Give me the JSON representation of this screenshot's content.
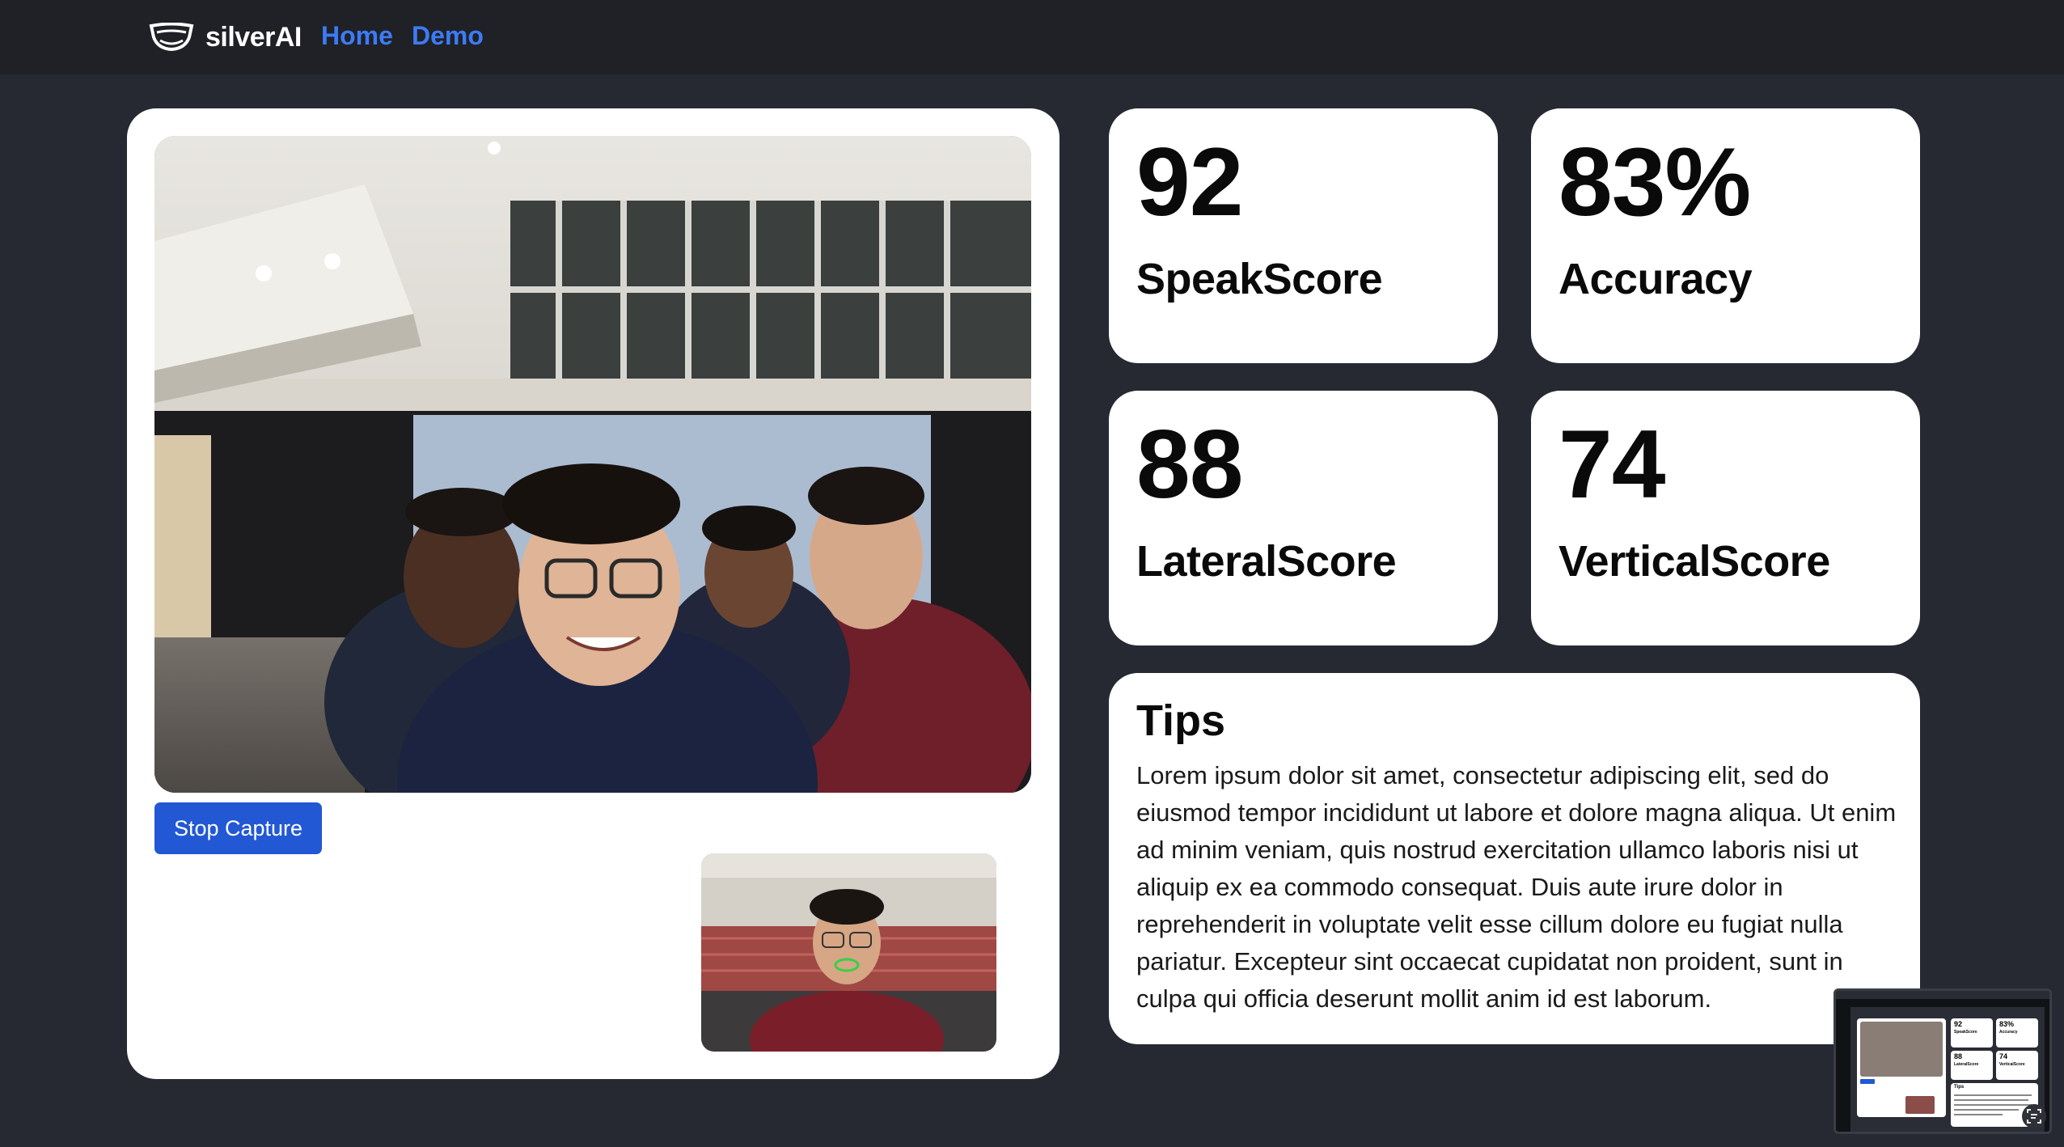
{
  "navbar": {
    "brand_name": "silverAI",
    "links": [
      {
        "label": "Home"
      },
      {
        "label": "Demo"
      }
    ]
  },
  "capture": {
    "stop_button_label": "Stop Capture"
  },
  "stats": {
    "speak": {
      "value": "92",
      "label": "SpeakScore"
    },
    "accuracy": {
      "value": "83%",
      "label": "Accuracy"
    },
    "lateral": {
      "value": "88",
      "label": "LateralScore"
    },
    "vertical": {
      "value": "74",
      "label": "VerticalScore"
    }
  },
  "tips": {
    "title": "Tips",
    "body": "Lorem ipsum dolor sit amet, consectetur adipiscing elit, sed do eiusmod tempor incididunt ut labore et dolore magna aliqua. Ut enim ad minim veniam, quis nostrud exercitation ullamco laboris nisi ut aliquip ex ea commodo consequat. Duis aute irure dolor in reprehenderit in voluptate velit esse cillum dolore eu fugiat nulla pariatur. Excepteur sint occaecat cupidatat non proident, sunt in culpa qui officia deserunt mollit anim id est laborum."
  },
  "preview": {
    "speak_value": "92",
    "speak_label": "SpeakScore",
    "acc_value": "83%",
    "acc_label": "Accuracy",
    "lat_value": "88",
    "lat_label": "LateralScore",
    "vert_value": "74",
    "vert_label": "VerticalScore",
    "tips_title": "Tips"
  },
  "colors": {
    "page_bg": "#262932",
    "navbar_bg": "#1f2126",
    "link_color": "#3d7bf5",
    "button_bg": "#2258d4",
    "card_bg": "#ffffff"
  },
  "icons": {
    "brand": "visor-logo-icon",
    "preview_action": "scan-text-icon"
  }
}
